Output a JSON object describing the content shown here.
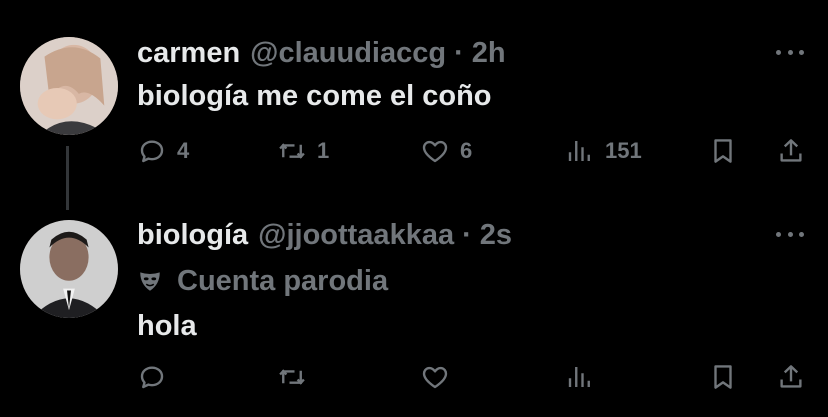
{
  "tweets": [
    {
      "display_name": "carmen",
      "handle": "@clauudiaccg",
      "time": "2h",
      "text": "biología me come el coño",
      "stats": {
        "replies": "4",
        "retweets": "1",
        "likes": "6",
        "views": "151"
      }
    },
    {
      "display_name": "biología",
      "handle": "@jjoottaakkaa",
      "time": "2s",
      "badge": "Cuenta parodia",
      "text": "hola",
      "stats": {
        "replies": "",
        "retweets": "",
        "likes": "",
        "views": ""
      }
    }
  ],
  "separator": "·",
  "icons": {
    "reply": "reply-icon",
    "retweet": "retweet-icon",
    "like": "heart-icon",
    "views": "views-icon",
    "bookmark": "bookmark-icon",
    "share": "share-icon",
    "more": "more-icon",
    "parody": "mask-icon"
  },
  "colors": {
    "background": "#000000",
    "text_primary": "#e7e9ea",
    "text_secondary": "#71767b",
    "thread_line": "#333639"
  }
}
